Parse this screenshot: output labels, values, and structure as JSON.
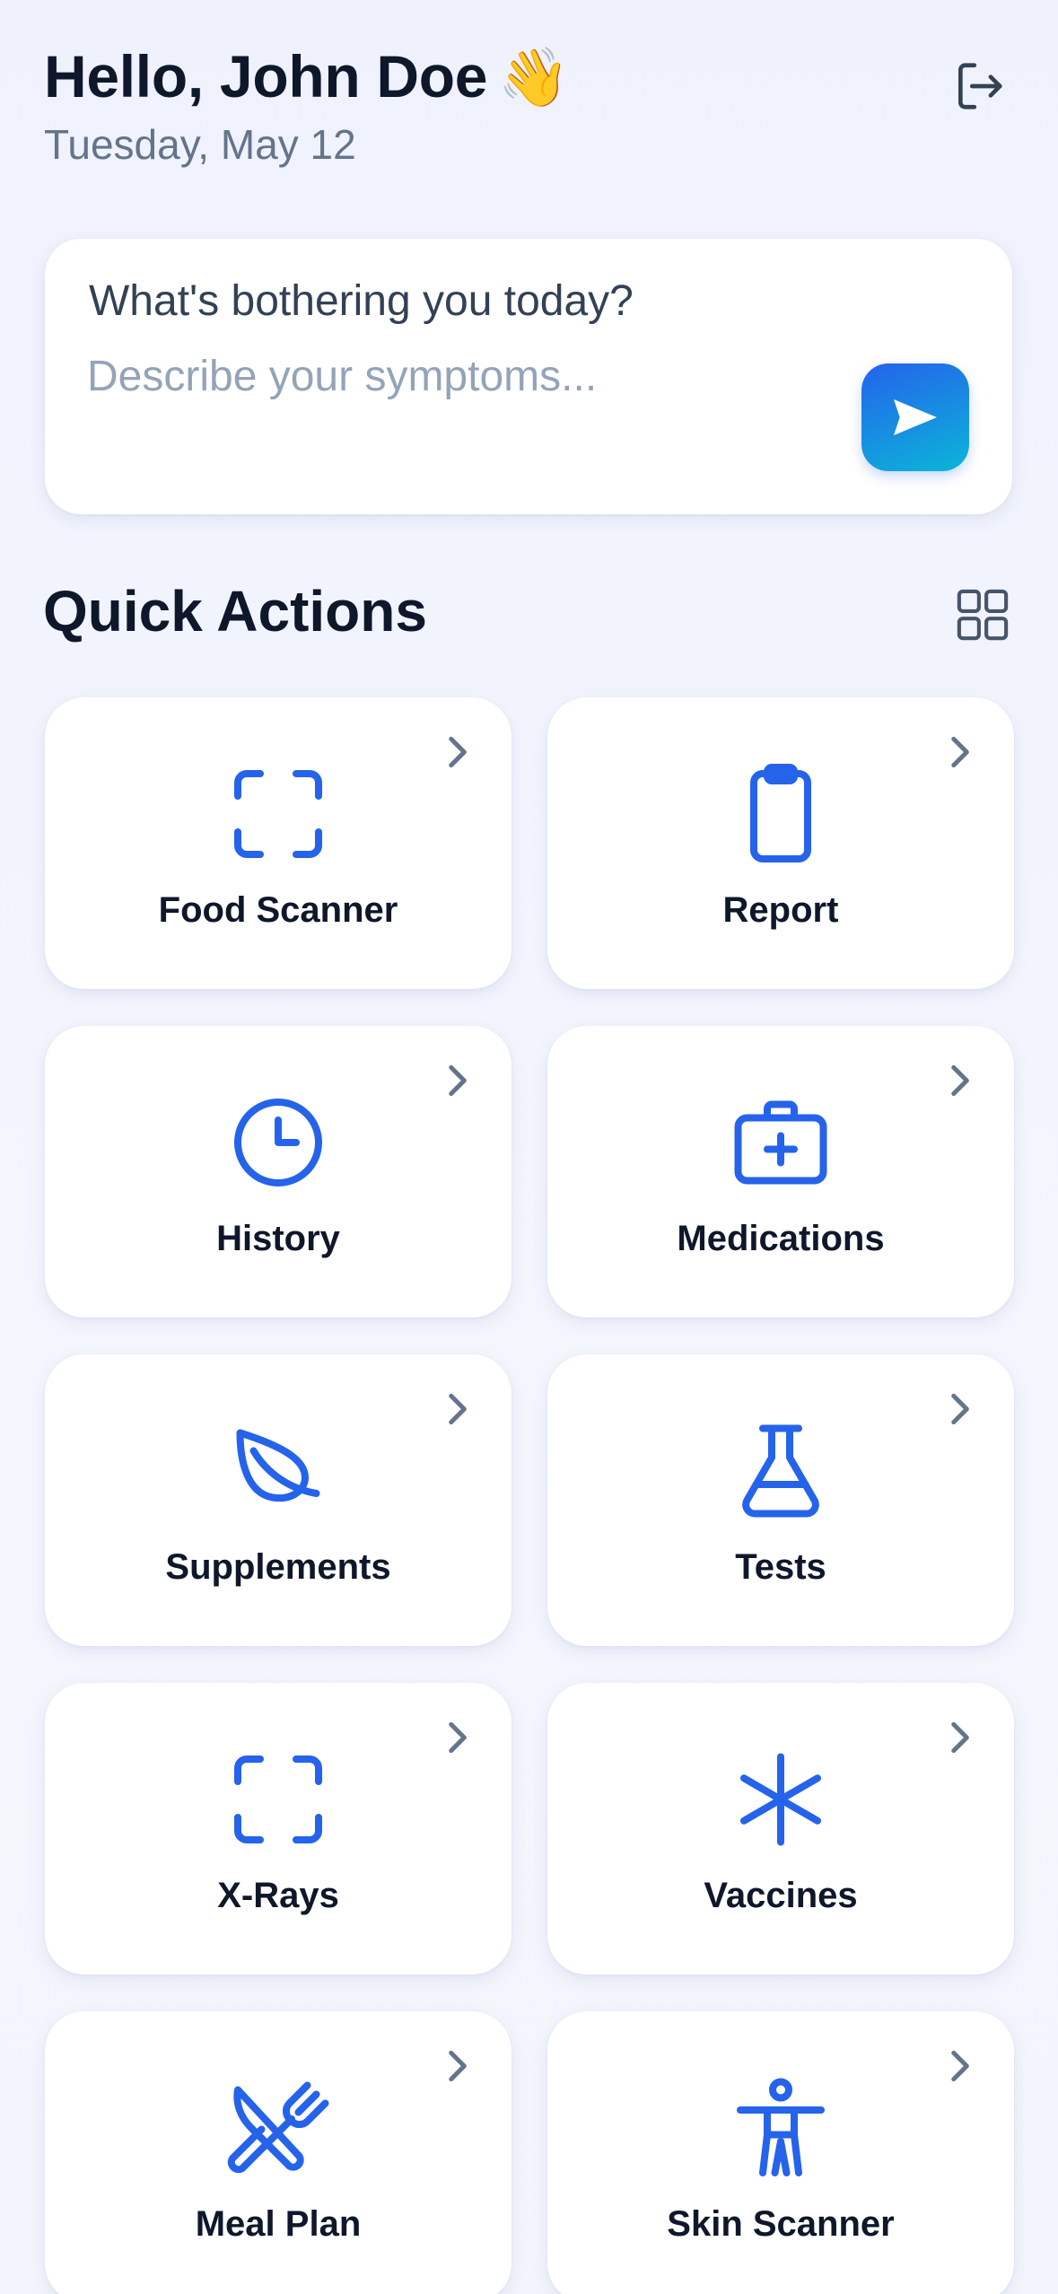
{
  "header": {
    "greeting": "Hello, John Doe",
    "wave_emoji": "👋",
    "date": "Tuesday, May 12",
    "logout_icon": "logout-icon"
  },
  "symptom_card": {
    "question": "What's bothering you today?",
    "placeholder": "Describe your symptoms...",
    "value": "",
    "send_icon": "send-icon"
  },
  "quick_actions": {
    "title": "Quick Actions",
    "layout_icon": "grid-view-icon",
    "items": [
      {
        "label": "Food Scanner",
        "icon": "scan-icon"
      },
      {
        "label": "Report",
        "icon": "clipboard-icon"
      },
      {
        "label": "History",
        "icon": "clock-icon"
      },
      {
        "label": "Medications",
        "icon": "medical-kit-icon"
      },
      {
        "label": "Supplements",
        "icon": "leaf-icon"
      },
      {
        "label": "Tests",
        "icon": "flask-icon"
      },
      {
        "label": "X-Rays",
        "icon": "scan-icon"
      },
      {
        "label": "Vaccines",
        "icon": "asterisk-icon"
      },
      {
        "label": "Meal Plan",
        "icon": "utensils-icon"
      },
      {
        "label": "Skin Scanner",
        "icon": "person-icon"
      }
    ]
  },
  "colors": {
    "accent": "#2563eb",
    "accent_gradient_end": "#0bb5d9",
    "background": "#f0f3fd",
    "text_primary": "#0f172a",
    "text_secondary": "#64748b",
    "placeholder": "#94a3b8",
    "chevron": "#64748b"
  }
}
